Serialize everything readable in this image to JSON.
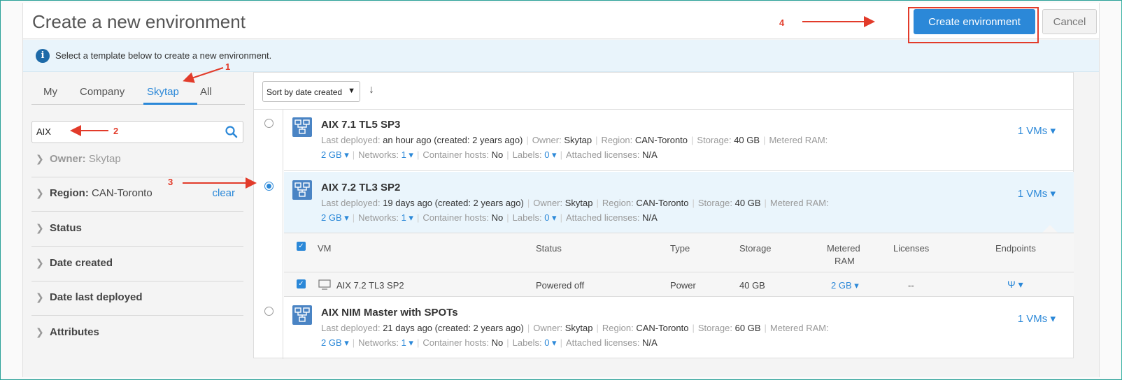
{
  "header": {
    "title": "Create a new environment",
    "create_label": "Create environment",
    "cancel_label": "Cancel"
  },
  "info": {
    "icon": "info-icon",
    "text": "Select a template below to create a new environment."
  },
  "tabs": [
    "My",
    "Company",
    "Skytap",
    "All"
  ],
  "active_tab": "Skytap",
  "search": {
    "value": "AIX",
    "icon": "search-icon"
  },
  "filters": {
    "owner": {
      "label": "Owner:",
      "value": "Skytap"
    },
    "region": {
      "label": "Region:",
      "value": "CAN-Toronto",
      "clear": "clear"
    },
    "status": "Status",
    "date_created": "Date created",
    "date_last_deployed": "Date last deployed",
    "attributes": "Attributes"
  },
  "sort": {
    "value": "Sort by date created",
    "arrow": "↓"
  },
  "meta_labels": {
    "last_deployed": "Last deployed:",
    "owner": "Owner:",
    "region": "Region:",
    "storage": "Storage:",
    "metered_ram": "Metered RAM:",
    "networks": "Networks:",
    "container_hosts": "Container hosts:",
    "labels": "Labels:",
    "attached_licenses": "Attached licenses:"
  },
  "environments": [
    {
      "name": "AIX 7.1 TL5 SP3",
      "last_deployed": "an hour ago (created: 2 years ago)",
      "owner": "Skytap",
      "region": "CAN-Toronto",
      "storage": "40 GB",
      "ram": "2 GB",
      "networks": "1",
      "container_hosts": "No",
      "labels": "0",
      "attached_licenses": "N/A",
      "vms": "1 VMs",
      "selected": false
    },
    {
      "name": "AIX 7.2 TL3 SP2",
      "last_deployed": "19 days ago (created: 2 years ago)",
      "owner": "Skytap",
      "region": "CAN-Toronto",
      "storage": "40 GB",
      "ram": "2 GB",
      "networks": "1",
      "container_hosts": "No",
      "labels": "0",
      "attached_licenses": "N/A",
      "vms": "1 VMs",
      "selected": true
    },
    {
      "name": "AIX NIM Master with SPOTs",
      "last_deployed": "21 days ago (created: 2 years ago)",
      "owner": "Skytap",
      "region": "CAN-Toronto",
      "storage": "60 GB",
      "ram": "2 GB",
      "networks": "1",
      "container_hosts": "No",
      "labels": "0",
      "attached_licenses": "N/A",
      "vms": "1 VMs",
      "selected": false
    }
  ],
  "vm_table": {
    "headers": {
      "vm": "VM",
      "status": "Status",
      "type": "Type",
      "storage": "Storage",
      "metered_ram_1": "Metered",
      "metered_ram_2": "RAM",
      "licenses": "Licenses",
      "endpoints": "Endpoints"
    },
    "row": {
      "vm": "AIX 7.2 TL3 SP2",
      "status": "Powered off",
      "type": "Power",
      "storage": "40 GB",
      "ram": "2 GB",
      "licenses": "--",
      "endpoints_icon": "endpoint-icon"
    }
  },
  "annotations": {
    "n1": "1",
    "n2": "2",
    "n3": "3",
    "n4": "4",
    "color": "#e23b2a"
  },
  "colors": {
    "accent": "#2b88d8",
    "info_bg": "#e9f4fb",
    "selected_bg": "#eaf5fc"
  }
}
